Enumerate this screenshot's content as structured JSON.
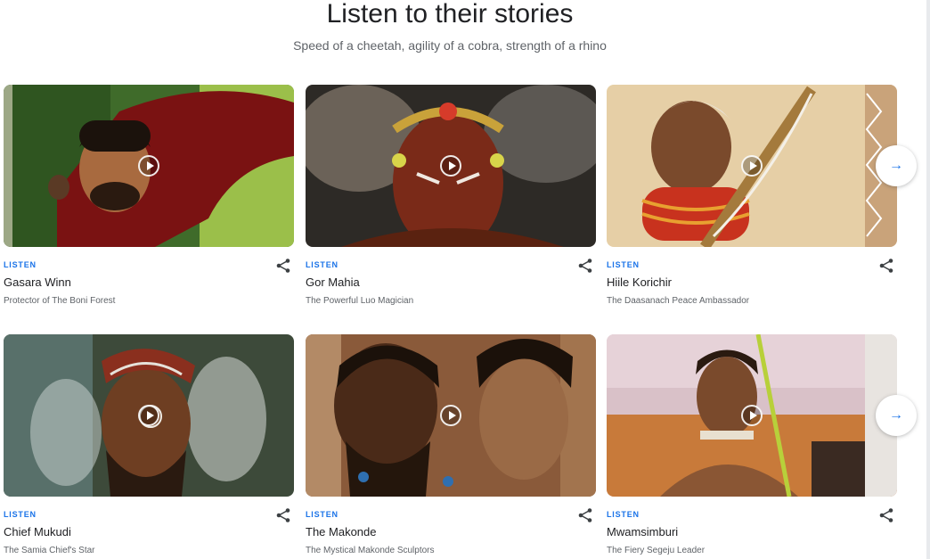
{
  "header": {
    "title": "Listen to their stories",
    "subtitle": "Speed of a cheetah, agility of a cobra, strength of a rhino"
  },
  "cards": [
    {
      "listen_label": "LISTEN",
      "name": "Gasara Winn",
      "description": "Protector of The Boni Forest"
    },
    {
      "listen_label": "LISTEN",
      "name": "Gor Mahia",
      "description": "The Powerful Luo Magician"
    },
    {
      "listen_label": "LISTEN",
      "name": "Hiile Korichir",
      "description": "The Daasanach Peace Ambassador"
    },
    {
      "listen_label": "LISTEN",
      "name": "Chief Mukudi",
      "description": "The Samia Chief's Star"
    },
    {
      "listen_label": "LISTEN",
      "name": "The Makonde",
      "description": "The Mystical Makonde Sculptors"
    },
    {
      "listen_label": "LISTEN",
      "name": "Mwamsimburi",
      "description": "The Fiery Segeju Leader"
    }
  ],
  "icons": {
    "play": "play-icon",
    "share": "share-icon",
    "next": "arrow-right-icon"
  },
  "colors": {
    "accent": "#1a73e8",
    "title": "#202124",
    "secondary_text": "#5f6368"
  }
}
